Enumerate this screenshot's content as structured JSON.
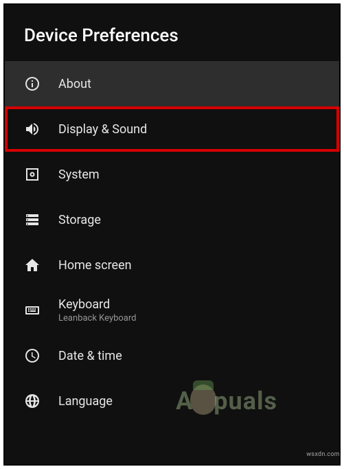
{
  "header": {
    "title": "Device Preferences"
  },
  "items": [
    {
      "icon": "info-icon",
      "label": "About",
      "selected": true,
      "highlighted": false
    },
    {
      "icon": "volume-icon",
      "label": "Display & Sound",
      "selected": false,
      "highlighted": true
    },
    {
      "icon": "system-icon",
      "label": "System",
      "selected": false,
      "highlighted": false
    },
    {
      "icon": "storage-icon",
      "label": "Storage",
      "selected": false,
      "highlighted": false
    },
    {
      "icon": "home-icon",
      "label": "Home screen",
      "selected": false,
      "highlighted": false
    },
    {
      "icon": "keyboard-icon",
      "label": "Keyboard",
      "sublabel": "Leanback Keyboard",
      "selected": false,
      "highlighted": false
    },
    {
      "icon": "clock-icon",
      "label": "Date & time",
      "selected": false,
      "highlighted": false
    },
    {
      "icon": "globe-icon",
      "label": "Language",
      "selected": false,
      "highlighted": false
    }
  ],
  "watermarks": {
    "corner": "wsxdn.com",
    "logo_left": "A",
    "logo_right": "puals"
  }
}
